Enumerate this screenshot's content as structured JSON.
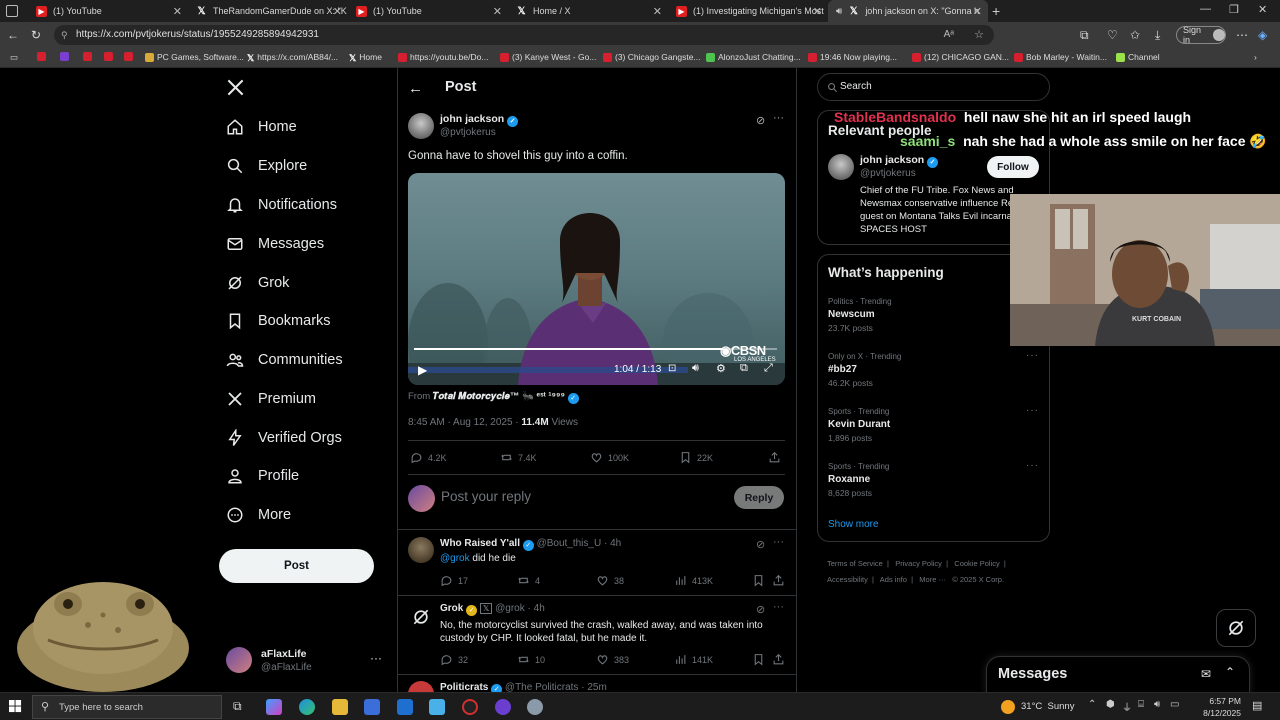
{
  "tabs": [
    {
      "label": "(1) YouTube",
      "icon": "youtube-icon"
    },
    {
      "label": "TheRandomGamerDude on X: \"K",
      "icon": "x-logo-icon"
    },
    {
      "label": "(1) YouTube",
      "icon": "youtube-icon"
    },
    {
      "label": "Home / X",
      "icon": "x-logo-icon"
    },
    {
      "label": "(1) Investigating Michigan's Most",
      "icon": "youtube-icon"
    },
    {
      "label": "john jackson on X: \"Gonna h",
      "icon": "x-logo-icon"
    }
  ],
  "browser": {
    "url": "https://x.com/pvtjokerus/status/1955249285894942931",
    "signin_label": "Sign in"
  },
  "bookmarks": [
    "PC Games, Software...",
    "https://x.com/AB84/...",
    "Home",
    "https://youtu.be/Do...",
    "(3) Kanye West - Go...",
    "(3) Chicago Gangste...",
    "AlonzoJust Chatting...",
    "19:46 Now playing...",
    "(12) CHICAGO GAN...",
    "Bob Marley - Waitin...",
    "Channel"
  ],
  "nav": {
    "items": [
      "Home",
      "Explore",
      "Notifications",
      "Messages",
      "Grok",
      "Bookmarks",
      "Communities",
      "Premium",
      "Verified Orgs",
      "Profile",
      "More"
    ],
    "post_label": "Post",
    "account_name": "aFlaxLife",
    "account_handle": "@aFlaxLife"
  },
  "post": {
    "header": "Post",
    "author": "john jackson",
    "handle": "@pvtjokerus",
    "text": "Gonna have to shovel this guy into a coffin.",
    "video_time": "1:04 / 1:13",
    "video_watermark": "CBSN",
    "video_watermark_sub": "LOS ANGELES",
    "from_label": "From",
    "from_source": "𝑻𝒐𝒕𝒂𝒍 𝑴𝒐𝒕𝒐𝒓𝒄𝒚𝒄𝒍𝒆™ 🐜 ᵉˢᵗ ¹⁹⁹⁹",
    "timestamp": "8:45 AM · Aug 12, 2025 · ",
    "views": "11.4M",
    "views_label": " Views",
    "replies": "4.2K",
    "reposts": "7.4K",
    "likes": "100K",
    "bookmarks": "22K",
    "reply_placeholder": "Post your reply",
    "reply_button": "Reply",
    "video_progress": 0.85
  },
  "replies": [
    {
      "author": "Who Raised Y'all",
      "handle": "@Bout_this_U",
      "time": "· 4h",
      "mention": "@grok",
      "text": " did he die",
      "stats": {
        "replies": "17",
        "reposts": "4",
        "likes": "38",
        "views": "413K"
      }
    },
    {
      "author": "Grok",
      "handle": "@grok",
      "time": "· 4h",
      "text": "No, the motorcyclist survived the crash, walked away, and was taken into custody by CHP. It looked fatal, but he made it.",
      "stats": {
        "replies": "32",
        "reposts": "10",
        "likes": "383",
        "views": "141K"
      }
    },
    {
      "author": "Politicrats",
      "handle": "@The Politicrats",
      "time": "· 25m"
    }
  ],
  "right": {
    "search_placeholder": "Search",
    "relevant_title": "Relevant people",
    "relevant": {
      "name": "john jackson",
      "handle": "@pvtjokerus",
      "follow": "Follow",
      "bio": "Chief of the FU Tribe. Fox News and Newsmax conservative influence Regular guest on Montana Talks Evil incarnate. SPACES HOST"
    },
    "happening_title": "What’s happening",
    "trends": [
      {
        "cat": "Politics · Trending",
        "name": "Newscum",
        "count": "23.7K posts"
      },
      {
        "cat": "Only on X · Trending",
        "name": "#bb27",
        "count": "46.2K posts"
      },
      {
        "cat": "Sports · Trending",
        "name": "Kevin Durant",
        "count": "1,896 posts"
      },
      {
        "cat": "Sports · Trending",
        "name": "Roxanne",
        "count": "8,628 posts"
      }
    ],
    "show_more": "Show more",
    "footer": [
      "Terms of Service",
      "Privacy Policy",
      "Cookie Policy",
      "Accessibility",
      "Ads info",
      "More ···",
      "© 2025 X Corp."
    ],
    "messages_title": "Messages"
  },
  "stream_chat": [
    {
      "user": "StableBandsnaldo",
      "msg": "hell naw she hit an irl speed laugh",
      "color": "#e0314f"
    },
    {
      "user": "saami_s",
      "msg": "nah she had a whole ass smile on her face 🤣",
      "color": "#8fe07a"
    }
  ],
  "webcam": {
    "shirt_text": "KURT COBAIN"
  },
  "taskbar": {
    "search_placeholder": "Type here to search",
    "weather": "31°C  Sunny",
    "time": "6:57 PM",
    "date": "8/12/2025"
  }
}
